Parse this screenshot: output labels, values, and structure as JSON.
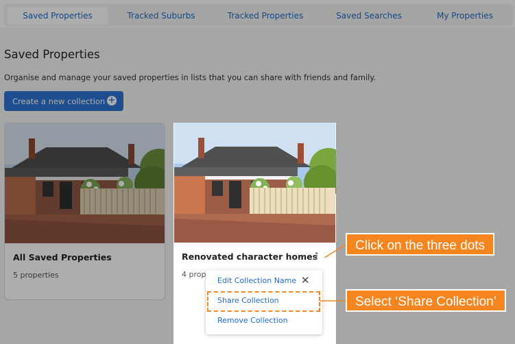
{
  "tabs": [
    {
      "label": "Saved Properties",
      "active": true
    },
    {
      "label": "Tracked Suburbs",
      "active": false
    },
    {
      "label": "Tracked Properties",
      "active": false
    },
    {
      "label": "Saved Searches",
      "active": false
    },
    {
      "label": "My Properties",
      "active": false
    }
  ],
  "page": {
    "title": "Saved Properties",
    "description": "Organise and manage your saved properties in lists that you can share with friends and family.",
    "create_button": "Create a new collection"
  },
  "cards": [
    {
      "title": "All Saved Properties",
      "count": "5 properties"
    },
    {
      "title": "Renovated character homes",
      "count": "4 prop"
    }
  ],
  "menu": {
    "edit": "Edit Collection Name",
    "share": "Share Collection",
    "remove": "Remove Collection"
  },
  "callouts": {
    "dots": "Click on the three dots",
    "share": "Select ‘Share Collection’"
  },
  "colors": {
    "accent": "#2d74d2",
    "callout": "#f5851f"
  }
}
